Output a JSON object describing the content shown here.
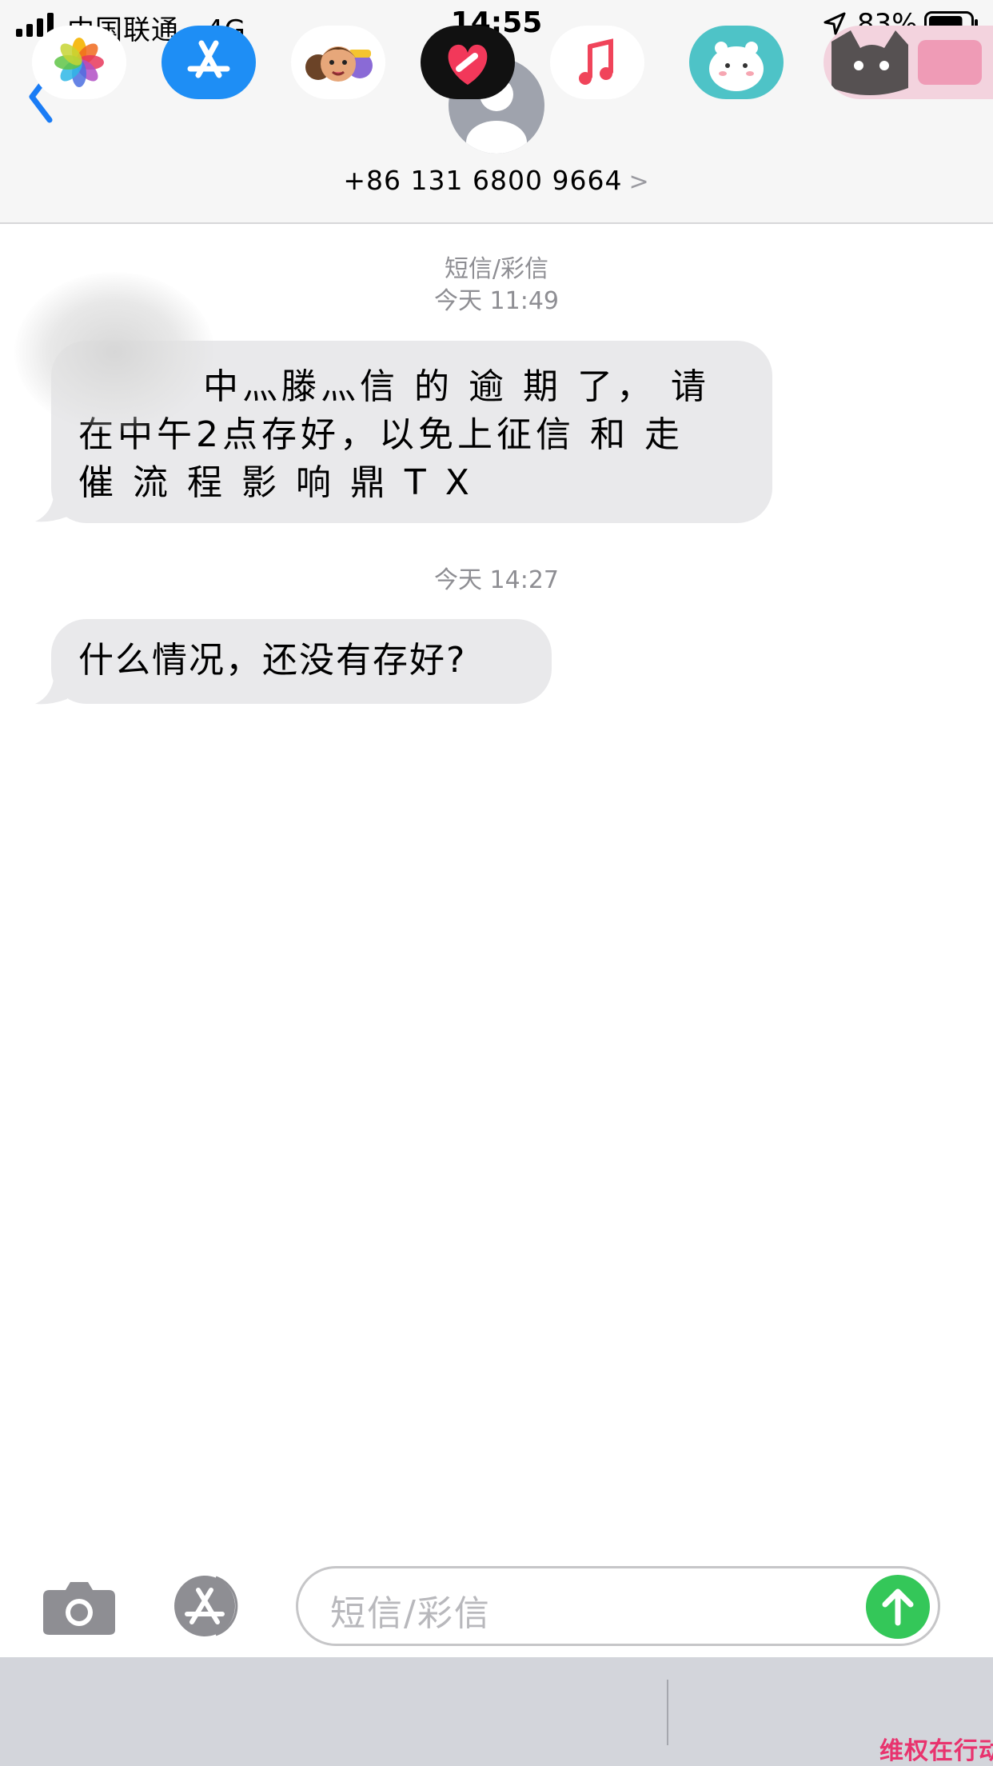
{
  "status_bar": {
    "carrier": "中国联通",
    "network": "4G",
    "time": "14:55",
    "battery_percent": "83%",
    "battery_level": 0.83
  },
  "header": {
    "contact": "+86 131 6800 9664",
    "accent_color": "#1a7cf5"
  },
  "conversation": {
    "service_label": "短信/彩信",
    "messages": [
      {
        "timestamp": "今天 11:49",
        "lines": [
          "中灬滕灬信 的 逾 期 了， 请",
          "在中午2点存好，以免上征信 和 走",
          "催 流 程 影 响 鼎 T X"
        ]
      },
      {
        "timestamp": "今天 14:27",
        "lines": [
          "什么情况，还没有存好?"
        ]
      }
    ]
  },
  "composer": {
    "placeholder": "短信/彩信",
    "send_color": "#34c759"
  },
  "app_drawer": {
    "icons": [
      "photos-icon",
      "app-store-icon",
      "memoji-icon",
      "digital-touch-icon",
      "music-icon",
      "sticker-app-icon",
      "black-cat-icon"
    ]
  },
  "watermark": {
    "text": "维权在行动"
  }
}
